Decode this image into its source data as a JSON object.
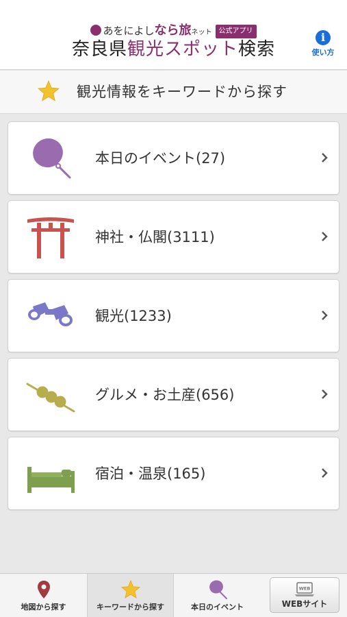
{
  "header": {
    "brand": {
      "prefix": "あをによし",
      "emphasis": "なら旅",
      "suffix": "ネット",
      "badge": "公式アプリ"
    },
    "title": {
      "part1": "奈良県",
      "accent": "観光スポット",
      "part2": "検索"
    },
    "help_label": "使い方",
    "help_icon": "info-icon"
  },
  "subheader": {
    "icon": "star-icon",
    "title": "観光情報をキーワードから探す"
  },
  "categories": [
    {
      "label": "本日のイベント(27)",
      "icon": "uchiwa-fan-icon",
      "color": "#9b6bb0"
    },
    {
      "label": "神社・仏閣(3111)",
      "icon": "torii-gate-icon",
      "color": "#c9524e"
    },
    {
      "label": "観光(1233)",
      "icon": "binoculars-icon",
      "color": "#7b78c8"
    },
    {
      "label": "グルメ・お土産(656)",
      "icon": "dango-icon",
      "color": "#b7ad4f"
    },
    {
      "label": "宿泊・温泉(165)",
      "icon": "bed-icon",
      "color": "#7ea04e"
    }
  ],
  "tabbar": {
    "tabs": [
      {
        "label": "地図から探す",
        "icon": "map-pin-icon",
        "active": false
      },
      {
        "label": "キーワードから探す",
        "icon": "star-icon",
        "active": true
      },
      {
        "label": "本日のイベント",
        "icon": "uchiwa-fan-icon",
        "active": false
      }
    ],
    "web_button": {
      "label": "WEBサイト",
      "icon_text": "WEB",
      "icon": "laptop-icon"
    }
  },
  "colors": {
    "brand": "#8a2f6e",
    "help": "#1a6ed8",
    "star": "#f2c22c"
  }
}
